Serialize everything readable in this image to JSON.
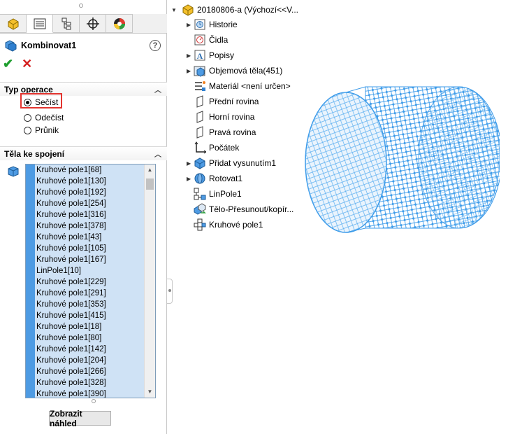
{
  "panel": {
    "title": "Kombinovat1",
    "help": "?",
    "ok": "✔",
    "cancel": "✕",
    "operation_section": "Typ operace",
    "operations": [
      "Sečíst",
      "Odečíst",
      "Průnik"
    ],
    "selected_operation": "Sečíst",
    "bodies_section": "Těla ke spojení",
    "bodies": [
      "Kruhové pole1[68]",
      "Kruhové pole1[130]",
      "Kruhové pole1[192]",
      "Kruhové pole1[254]",
      "Kruhové pole1[316]",
      "Kruhové pole1[378]",
      "Kruhové pole1[43]",
      "Kruhové pole1[105]",
      "Kruhové pole1[167]",
      "LinPole1[10]",
      "Kruhové pole1[229]",
      "Kruhové pole1[291]",
      "Kruhové pole1[353]",
      "Kruhové pole1[415]",
      "Kruhové pole1[18]",
      "Kruhové pole1[80]",
      "Kruhové pole1[142]",
      "Kruhové pole1[204]",
      "Kruhové pole1[266]",
      "Kruhové pole1[328]",
      "Kruhové pole1[390]"
    ],
    "preview_button": "Zobrazit náhled"
  },
  "tree": {
    "root": "20180806-a  (Výchozí<<V...",
    "nodes": [
      {
        "label": "Historie",
        "icon": "history-icon",
        "expandable": true
      },
      {
        "label": "Čidla",
        "icon": "sensor-icon",
        "expandable": false
      },
      {
        "label": "Popisy",
        "icon": "annotation-icon",
        "expandable": true
      },
      {
        "label": "Objemová těla(451)",
        "icon": "solid-bodies-icon",
        "expandable": true
      },
      {
        "label": "Materiál <není určen>",
        "icon": "material-icon",
        "expandable": false
      },
      {
        "label": "Přední rovina",
        "icon": "plane-icon",
        "expandable": false
      },
      {
        "label": "Horní rovina",
        "icon": "plane-icon",
        "expandable": false
      },
      {
        "label": "Pravá rovina",
        "icon": "plane-icon",
        "expandable": false
      },
      {
        "label": "Počátek",
        "icon": "origin-icon",
        "expandable": false
      },
      {
        "label": "Přidat vysunutím1",
        "icon": "extrude-icon",
        "expandable": true
      },
      {
        "label": "Rotovat1",
        "icon": "revolve-icon",
        "expandable": true
      },
      {
        "label": "LinPole1",
        "icon": "linear-pattern-icon",
        "expandable": false
      },
      {
        "label": "Tělo-Přesunout/kopír...",
        "icon": "move-body-icon",
        "expandable": false
      },
      {
        "label": "Kruhové pole1",
        "icon": "circular-pattern-icon",
        "expandable": false
      }
    ]
  },
  "colors": {
    "accent": "#4e9be3",
    "list_bg": "#cfe2f5",
    "highlight": "#e3342f",
    "model": "#3d9be9"
  }
}
